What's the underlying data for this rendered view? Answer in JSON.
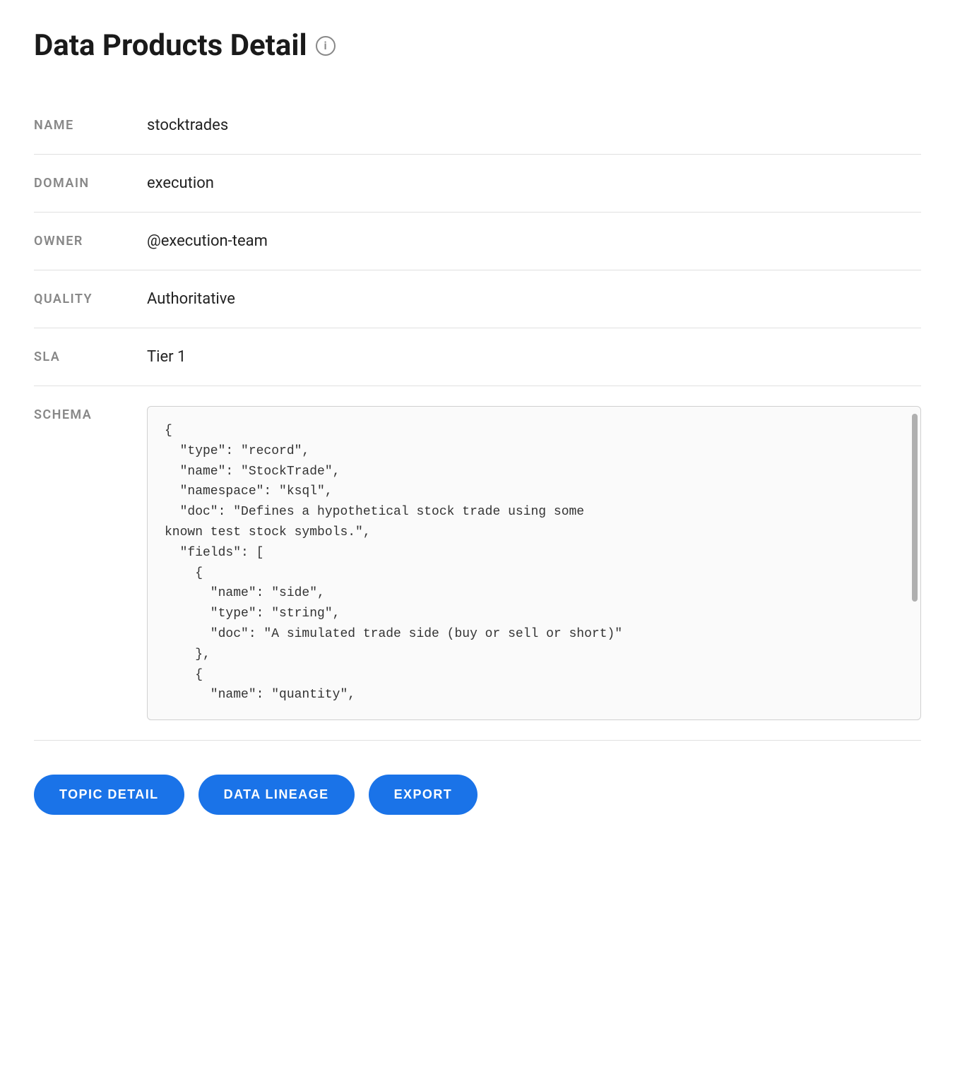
{
  "page": {
    "title": "Data Products Detail",
    "info_icon_label": "i"
  },
  "fields": {
    "name_label": "NAME",
    "name_value": "stocktrades",
    "domain_label": "DOMAIN",
    "domain_value": "execution",
    "owner_label": "OWNER",
    "owner_value": "@execution-team",
    "quality_label": "QUALITY",
    "quality_value": "Authoritative",
    "sla_label": "SLA",
    "sla_value": "Tier 1",
    "schema_label": "SCHEMA",
    "schema_value": "{\n  \"type\": \"record\",\n  \"name\": \"StockTrade\",\n  \"namespace\": \"ksql\",\n  \"doc\": \"Defines a hypothetical stock trade using some\nknown test stock symbols.\",\n  \"fields\": [\n    {\n      \"name\": \"side\",\n      \"type\": \"string\",\n      \"doc\": \"A simulated trade side (buy or sell or short)\"\n    },\n    {\n      \"name\": \"quantity\","
  },
  "buttons": {
    "topic_detail": "TOPIC DETAIL",
    "data_lineage": "DATA LINEAGE",
    "export": "EXPORT"
  }
}
